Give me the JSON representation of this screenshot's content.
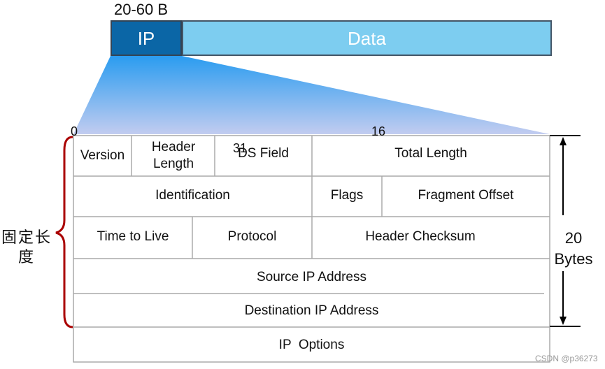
{
  "packet": {
    "size_label": "20-60 B",
    "ip": "IP",
    "data": "Data",
    "ip_color": "#0b66a6",
    "data_color": "#7dcdf0"
  },
  "bits": {
    "b0": "0",
    "b16": "16",
    "b31": "31"
  },
  "header": {
    "row1": [
      "Version",
      "Header Length",
      "DS Field",
      "Total Length"
    ],
    "row2": [
      "Identification",
      "Flags",
      "Fragment Offset"
    ],
    "row3": [
      "Time to Live",
      "Protocol",
      "Header Checksum"
    ],
    "row4": "Source IP Address",
    "row5": "Destination IP Address",
    "row6": "IP  Options"
  },
  "fixed_label": "固定长度",
  "bytes": {
    "value": "20",
    "unit": "Bytes"
  },
  "watermark": "CSDN @p36273"
}
